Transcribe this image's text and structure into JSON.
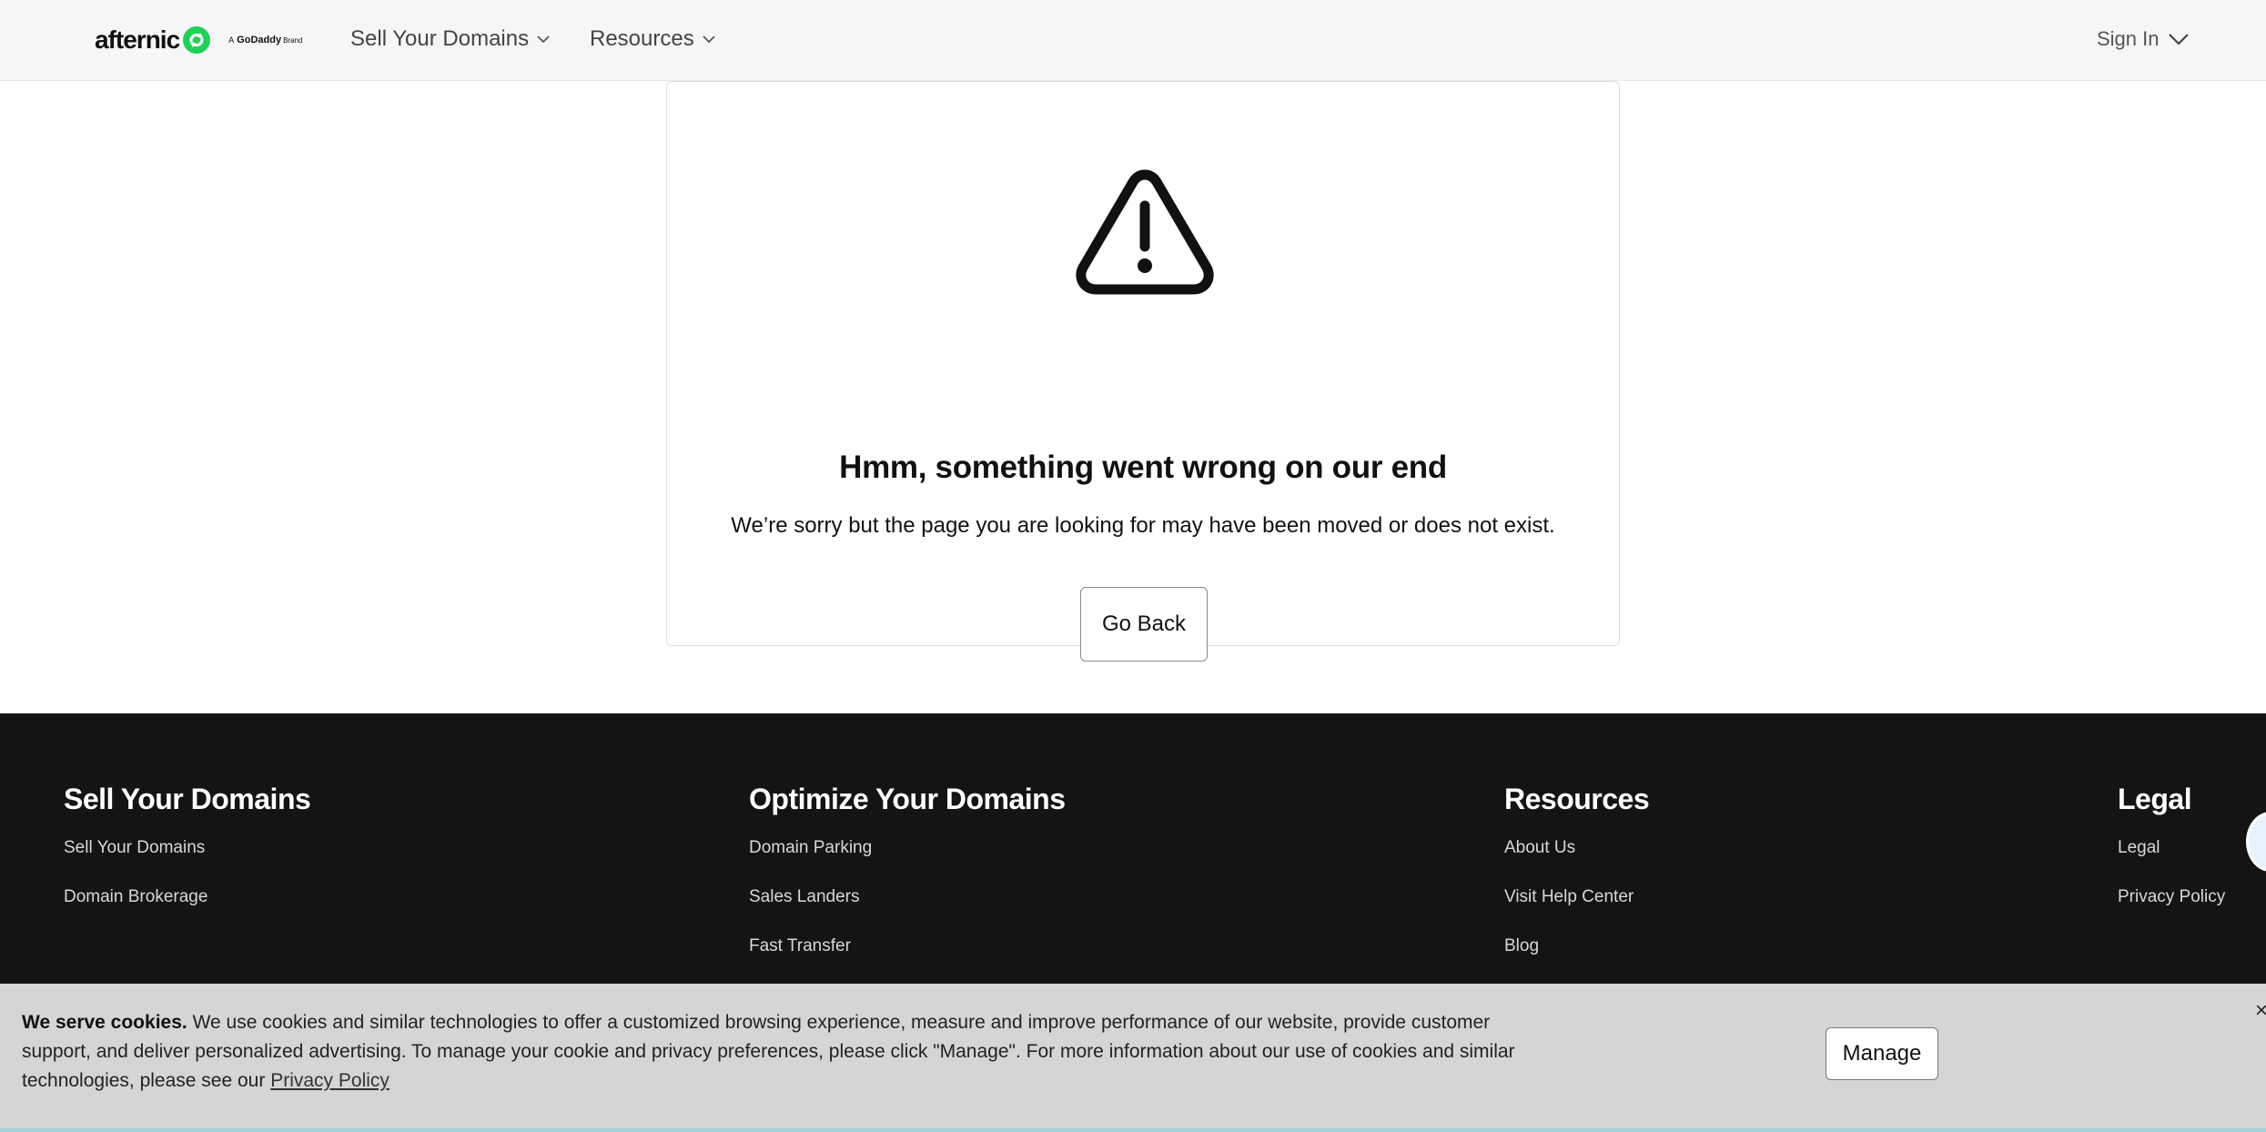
{
  "header": {
    "brand": "afternic",
    "godaddy_prefix": "A",
    "godaddy_name": "GoDaddy",
    "godaddy_suffix": "Brand",
    "nav": [
      {
        "label": "Sell Your Domains"
      },
      {
        "label": "Resources"
      }
    ],
    "sign_in": "Sign In"
  },
  "error": {
    "title": "Hmm, something went wrong on our end",
    "message": "We’re sorry but the page you are looking for may have been moved or does not exist.",
    "button": "Go Back"
  },
  "footer": {
    "columns": [
      {
        "heading": "Sell Your Domains",
        "links": [
          "Sell Your Domains",
          "Domain Brokerage"
        ]
      },
      {
        "heading": "Optimize Your Domains",
        "links": [
          "Domain Parking",
          "Sales Landers",
          "Fast Transfer"
        ]
      },
      {
        "heading": "Resources",
        "links": [
          "About Us",
          "Visit Help Center",
          "Blog"
        ]
      },
      {
        "heading": "Legal",
        "links": [
          "Legal",
          "Privacy Policy"
        ]
      }
    ]
  },
  "cookie": {
    "lead": "We serve cookies.",
    "body": "We use cookies and similar technologies to offer a customized browsing experience, measure and improve performance of our website, provide customer support, and deliver personalized advertising. To manage your cookie and privacy preferences, please click \"Manage\". For more information about our use of cookies and similar technologies, please see our",
    "link": "Privacy Policy",
    "manage": "Manage",
    "close": "×"
  },
  "colors": {
    "brand_green": "#1fd15a",
    "footer_bg": "#141414",
    "banner_bg": "#d5d5d5"
  }
}
